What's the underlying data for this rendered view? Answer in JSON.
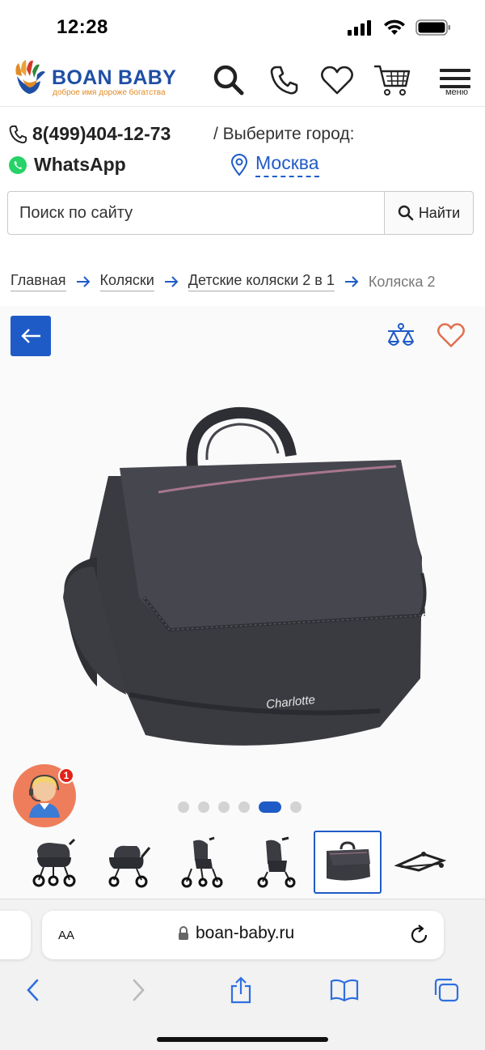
{
  "status_bar": {
    "time": "12:28"
  },
  "header": {
    "logo_name": "BOAN BABY",
    "logo_tagline": "доброе имя дороже богатства",
    "menu_label": "меню"
  },
  "contact": {
    "phone": "8(499)404-12-73",
    "whatsapp": "WhatsApp",
    "city_prompt": "/  Выберите город:",
    "city": "Москва"
  },
  "search": {
    "placeholder": "Поиск по сайту",
    "button_label": "Найти"
  },
  "breadcrumb": [
    {
      "label": "Главная"
    },
    {
      "label": "Коляски"
    },
    {
      "label": "Детские коляски 2 в 1"
    },
    {
      "label": "Коляска 2"
    }
  ],
  "product": {
    "brand_print": "Charlotte",
    "gallery_dots": 6,
    "active_dot": 5,
    "thumbnails": 6,
    "selected_thumbnail": 5
  },
  "chat": {
    "badge_count": "1"
  },
  "browser": {
    "aa_label": "AA",
    "url": "boan-baby.ru"
  },
  "colors": {
    "accent": "#1f5bc7",
    "logo_blue": "#1f4fa5",
    "tagline_orange": "#e08b27",
    "operator_bg": "#ee7d5b"
  }
}
